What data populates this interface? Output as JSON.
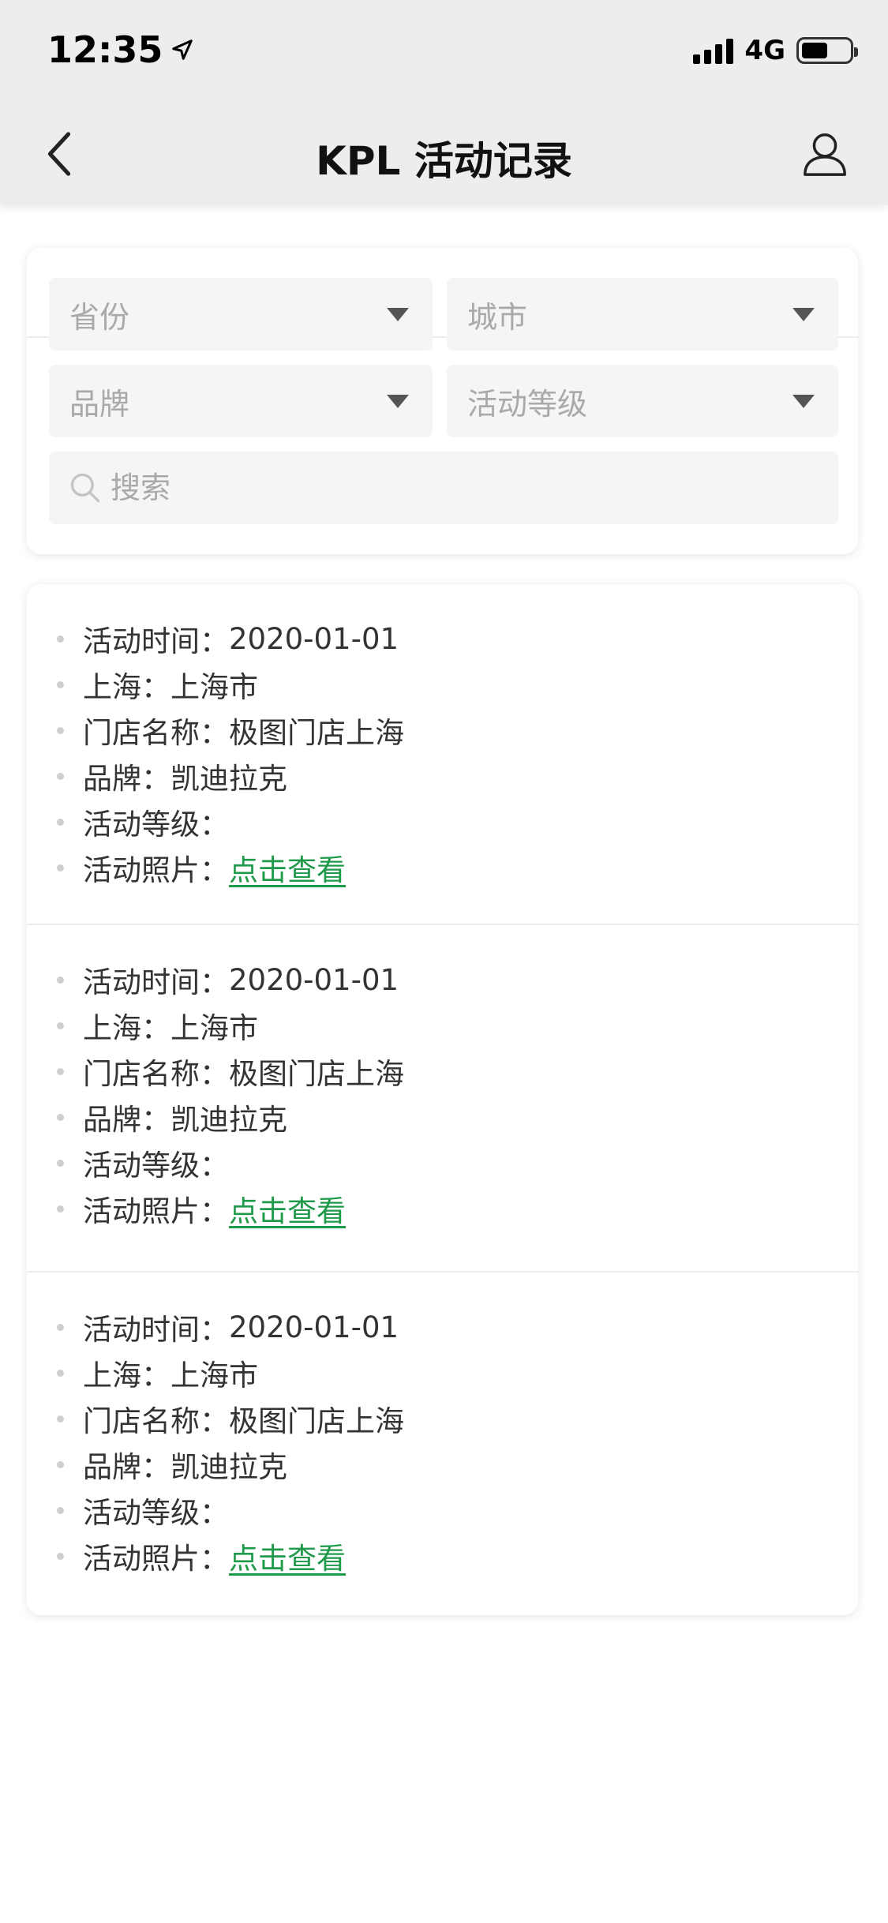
{
  "status_bar": {
    "time": "12:35",
    "network": "4G",
    "battery_level": 0.55,
    "location_icon": "location-arrow-icon"
  },
  "nav": {
    "title": "KPL 活动记录",
    "back_icon": "chevron-left-icon",
    "user_icon": "user-icon"
  },
  "filters": {
    "province_placeholder": "省份",
    "city_placeholder": "城市",
    "brand_placeholder": "品牌",
    "level_placeholder": "活动等级",
    "search_placeholder": "搜索"
  },
  "records": [
    {
      "time_label": "活动时间：",
      "time_value": "2020-01-01",
      "region_label": "上海：",
      "region_value": "上海市",
      "store_label": "门店名称：",
      "store_value": "极图门店上海",
      "brand_label": "品牌：",
      "brand_value": "凯迪拉克",
      "level_label": "活动等级：",
      "level_value": "",
      "photo_label": "活动照片：",
      "photo_link": "点击查看"
    },
    {
      "time_label": "活动时间：",
      "time_value": "2020-01-01",
      "region_label": "上海：",
      "region_value": "上海市",
      "store_label": "门店名称：",
      "store_value": "极图门店上海",
      "brand_label": "品牌：",
      "brand_value": "凯迪拉克",
      "level_label": "活动等级：",
      "level_value": "",
      "photo_label": "活动照片：",
      "photo_link": "点击查看"
    },
    {
      "time_label": "活动时间：",
      "time_value": "2020-01-01",
      "region_label": "上海：",
      "region_value": "上海市",
      "store_label": "门店名称：",
      "store_value": "极图门店上海",
      "brand_label": "品牌：",
      "brand_value": "凯迪拉克",
      "level_label": "活动等级：",
      "level_value": "",
      "photo_label": "活动照片：",
      "photo_link": "点击查看"
    }
  ],
  "colors": {
    "accent_link": "#1f9a4a",
    "header_bg": "#ededed",
    "field_bg": "#f5f5f5"
  }
}
